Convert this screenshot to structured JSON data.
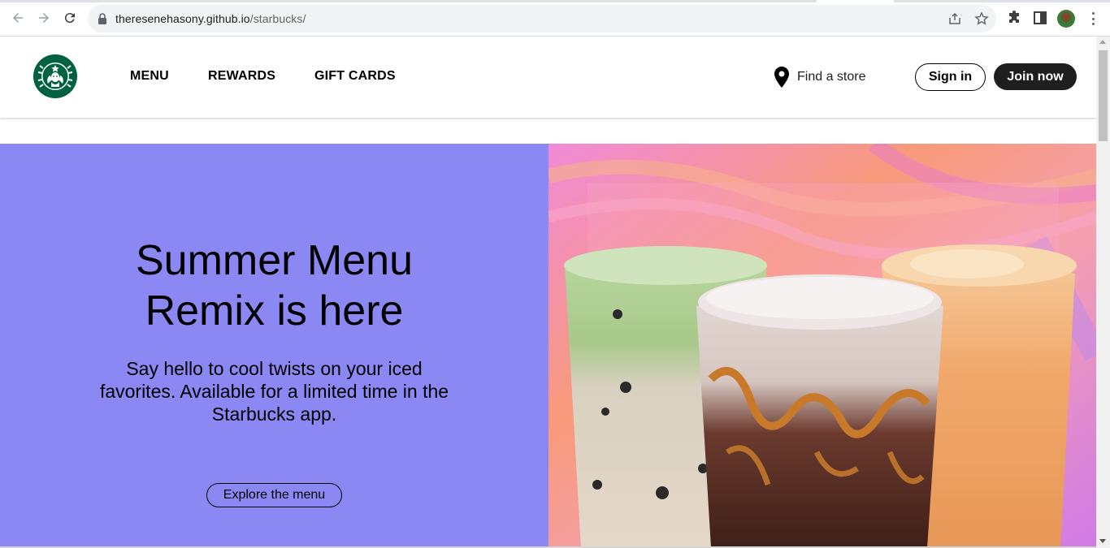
{
  "browser": {
    "url_host": "theresenehasony.github.io",
    "url_path": "/starbucks/"
  },
  "header": {
    "nav": [
      "MENU",
      "REWARDS",
      "GIFT CARDS"
    ],
    "find_store": "Find a store",
    "sign_in": "Sign in",
    "join_now": "Join now"
  },
  "hero": {
    "title_line1": "Summer Menu",
    "title_line2": "Remix is here",
    "subtitle": "Say hello to cool twists on your iced favorites. Available for a limited time in the Starbucks app.",
    "cta": "Explore the menu"
  },
  "colors": {
    "hero_bg": "#8c88f3",
    "brand_green": "#006241",
    "join_bg": "#1e1e1e"
  }
}
